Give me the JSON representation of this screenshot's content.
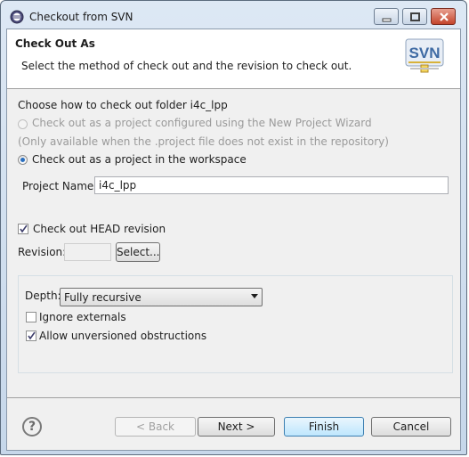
{
  "window": {
    "title": "Checkout from SVN"
  },
  "header": {
    "title": "Check Out As",
    "description": "Select the method of check out and the revision to check out.",
    "logo_text": "SVN"
  },
  "checkout": {
    "choose_label": "Choose how to check out folder i4c_lpp",
    "option_wizard": "Check out as a project configured using the New Project Wizard",
    "option_wizard_note": "(Only available when the .project file does not exist in the repository)",
    "option_workspace": "Check out as a project in the workspace",
    "project_name_label": "Project Name:",
    "project_name_value": "i4c_lpp"
  },
  "revision": {
    "head_label": "Check out HEAD revision",
    "head_checked": true,
    "revision_label": "Revision:",
    "revision_value": "",
    "select_button": "Select..."
  },
  "options": {
    "depth_label": "Depth:",
    "depth_value": "Fully recursive",
    "ignore_externals": "Ignore externals",
    "ignore_externals_checked": false,
    "allow_unversioned": "Allow unversioned obstructions",
    "allow_unversioned_checked": true
  },
  "footer": {
    "help": "?",
    "back": "< Back",
    "next": "Next >",
    "finish": "Finish",
    "cancel": "Cancel"
  }
}
